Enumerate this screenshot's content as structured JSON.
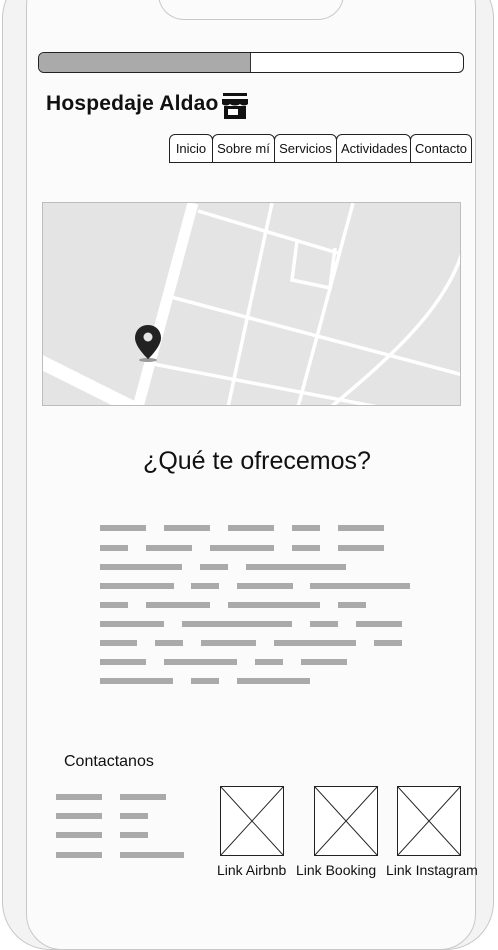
{
  "progress": {
    "value": 0.5
  },
  "header": {
    "title": "Hospedaje Aldao",
    "icon": "store-icon"
  },
  "nav": {
    "tabs": [
      {
        "label": "Inicio"
      },
      {
        "label": "Sobre mí"
      },
      {
        "label": "Servicios"
      },
      {
        "label": "Actividades"
      },
      {
        "label": "Contacto"
      }
    ]
  },
  "map": {
    "icon": "map-pin-icon"
  },
  "main": {
    "heading": "¿Qué te ofrecemos?"
  },
  "contact": {
    "label": "Contactanos",
    "links": [
      {
        "label": "Link Airbnb"
      },
      {
        "label": "Link Booking"
      },
      {
        "label": "Link Instagram"
      }
    ]
  },
  "colors": {
    "placeholder_text": "#aaaaaa",
    "map_bg": "#e4e4e4",
    "border": "#222222"
  }
}
